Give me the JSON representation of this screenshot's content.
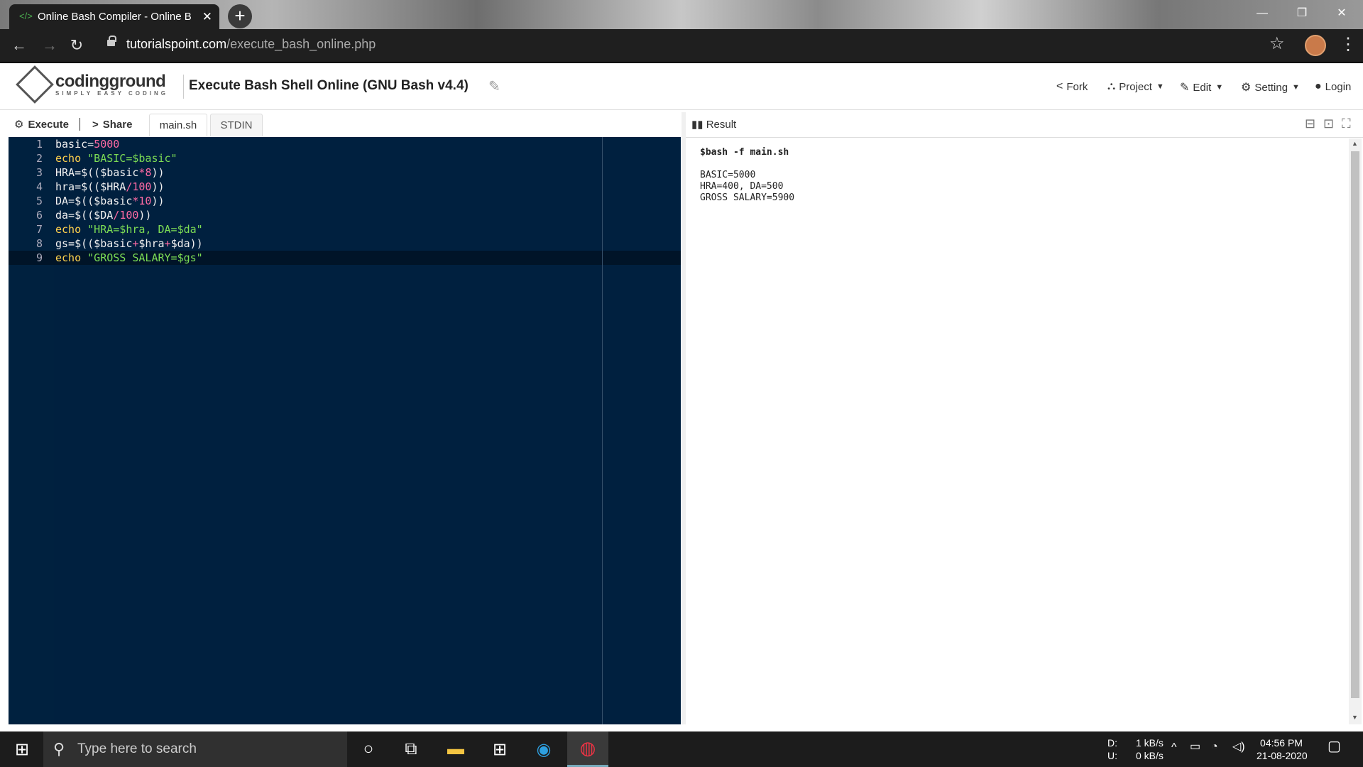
{
  "browser": {
    "tab_title": "Online Bash Compiler - Online B",
    "url_domain": "tutorialspoint.com",
    "url_path": "/execute_bash_online.php"
  },
  "header": {
    "logo_main": "codingground",
    "logo_sub": "SIMPLY EASY CODING",
    "title": "Execute Bash Shell Online (GNU Bash v4.4)",
    "menu": {
      "fork": "Fork",
      "project": "Project",
      "edit": "Edit",
      "setting": "Setting",
      "login": "Login"
    }
  },
  "editor_toolbar": {
    "execute": "Execute",
    "share": "Share",
    "tab_main": "main.sh",
    "tab_stdin": "STDIN"
  },
  "editor": {
    "lines": [
      {
        "num": "1",
        "code": "basic=5000"
      },
      {
        "num": "2",
        "code": "echo \"BASIC=$basic\""
      },
      {
        "num": "3",
        "code": "HRA=$(($basic*8))"
      },
      {
        "num": "4",
        "code": "hra=$(($HRA/100))"
      },
      {
        "num": "5",
        "code": "DA=$(($basic*10))"
      },
      {
        "num": "6",
        "code": "da=$(($DA/100))"
      },
      {
        "num": "7",
        "code": "echo \"HRA=$hra, DA=$da\""
      },
      {
        "num": "8",
        "code": "gs=$(($basic+$hra+$da))"
      },
      {
        "num": "9",
        "code": "echo \"GROSS SALARY=$gs\""
      }
    ]
  },
  "result": {
    "title": "Result",
    "command": "$bash -f main.sh",
    "output": [
      "BASIC=5000",
      "HRA=400, DA=500",
      "GROSS SALARY=5900"
    ]
  },
  "taskbar": {
    "search_placeholder": "Type here to search",
    "net_down_label": "D:",
    "net_up_label": "U:",
    "net_down": "1 kB/s",
    "net_up": "0 kB/s",
    "time": "04:56 PM",
    "date": "21-08-2020"
  }
}
